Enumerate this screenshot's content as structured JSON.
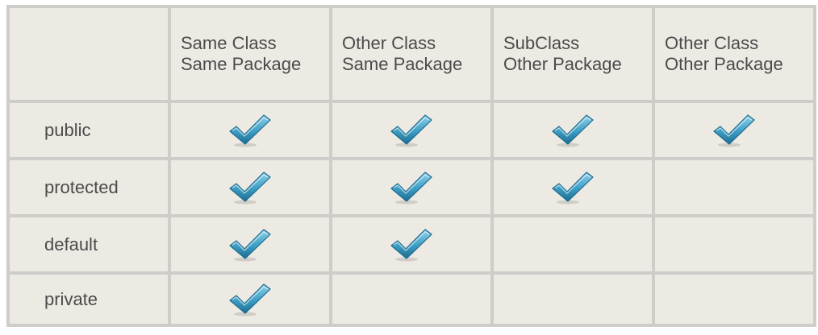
{
  "table": {
    "corner": "",
    "columns": [
      {
        "line1": "Same Class",
        "line2": "Same Package"
      },
      {
        "line1": "Other Class",
        "line2": "Same Package"
      },
      {
        "line1": "SubClass",
        "line2": "Other Package"
      },
      {
        "line1": "Other Class",
        "line2": "Other Package"
      }
    ],
    "rows": [
      {
        "label": "public",
        "access": [
          true,
          true,
          true,
          true
        ]
      },
      {
        "label": "protected",
        "access": [
          true,
          true,
          true,
          false
        ]
      },
      {
        "label": "default",
        "access": [
          true,
          true,
          false,
          false
        ]
      },
      {
        "label": "private",
        "access": [
          true,
          false,
          false,
          false
        ]
      }
    ]
  },
  "icons": {
    "check": "checkmark-icon"
  },
  "colors": {
    "cell_background": "#edeae4",
    "grid_lines": "#cfcdc9",
    "text": "#4b4b4b",
    "check_light": "#8fd0e8",
    "check_mid": "#3e9fc6",
    "check_dark": "#1d6c90"
  }
}
